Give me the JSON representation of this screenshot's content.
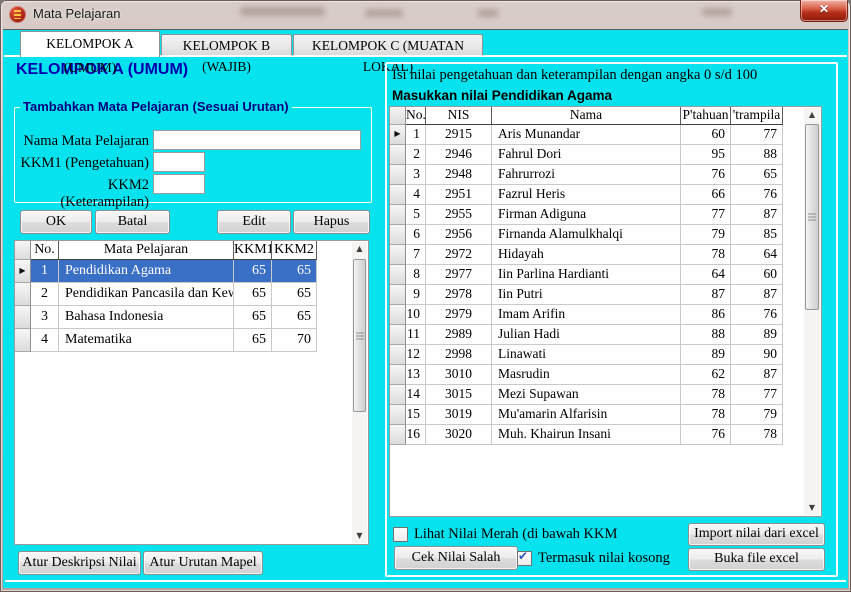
{
  "window": {
    "title": "Mata Pelajaran",
    "close_glyph": "✕"
  },
  "icons": {
    "up": "▲",
    "down": "▼",
    "row_arrow": "▶",
    "check": "✔"
  },
  "tabs": [
    {
      "label": "KELOMPOK A (UMUM)",
      "active": true
    },
    {
      "label": "KELOMPOK B (WAJIB)",
      "active": false
    },
    {
      "label": "KELOMPOK C (MUATAN LOKAL)",
      "active": false
    }
  ],
  "left": {
    "heading": "KELOMPOK A (UMUM)",
    "groupbox": {
      "dash": "-",
      "title": "Tambahkan Mata Pelajaran (Sesuai Urutan)",
      "fields": [
        {
          "label": "Nama Mata Pelajaran",
          "value": ""
        },
        {
          "label": "KKM1 (Pengetahuan)",
          "value": ""
        },
        {
          "label": "KKM2 (Keterampilan)",
          "value": ""
        }
      ]
    },
    "buttons": {
      "ok": "OK",
      "batal": "Batal",
      "edit": "Edit",
      "hapus": "Hapus"
    },
    "table": {
      "headers": [
        "No.",
        "Mata Pelajaran",
        "KKM1",
        "KKM2"
      ],
      "rows": [
        [
          "1",
          "Pendidikan Agama",
          "65",
          "65"
        ],
        [
          "2",
          "Pendidikan Pancasila dan Kewa",
          "65",
          "65"
        ],
        [
          "3",
          "Bahasa Indonesia",
          "65",
          "65"
        ],
        [
          "4",
          "Matematika",
          "65",
          "70"
        ]
      ],
      "selected_row": 0
    },
    "footer_buttons": {
      "deskripsi": "Atur Deskripsi Nilai",
      "urutan": "Atur Urutan Mapel"
    }
  },
  "right": {
    "dash": "-",
    "info_line": "Isi nilai pengetahuan dan keterampilan dengan angka 0 s/d 100",
    "subtitle": "Masukkan nilai Pendidikan Agama",
    "table": {
      "headers": [
        "No.",
        "NIS",
        "Nama",
        "P'tahuan",
        "'trampila"
      ],
      "rows": [
        [
          "1",
          "2915",
          "Aris Munandar",
          "60",
          "77"
        ],
        [
          "2",
          "2946",
          "Fahrul Dori",
          "95",
          "88"
        ],
        [
          "3",
          "2948",
          "Fahrurrozi",
          "76",
          "65"
        ],
        [
          "4",
          "2951",
          "Fazrul Heris",
          "66",
          "76"
        ],
        [
          "5",
          "2955",
          "Firman Adiguna",
          "77",
          "87"
        ],
        [
          "6",
          "2956",
          "Firnanda Alamulkhalqi",
          "79",
          "85"
        ],
        [
          "7",
          "2972",
          "Hidayah",
          "78",
          "64"
        ],
        [
          "8",
          "2977",
          "Iin Parlina Hardianti",
          "64",
          "60"
        ],
        [
          "9",
          "2978",
          "Iin Putri",
          "87",
          "87"
        ],
        [
          "10",
          "2979",
          "Imam Arifin",
          "86",
          "76"
        ],
        [
          "11",
          "2989",
          "Julian Hadi",
          "88",
          "89"
        ],
        [
          "12",
          "2998",
          "Linawati",
          "89",
          "90"
        ],
        [
          "13",
          "3010",
          "Masrudin",
          "62",
          "87"
        ],
        [
          "14",
          "3015",
          "Mezi Supawan",
          "78",
          "77"
        ],
        [
          "15",
          "3019",
          "Mu'amarin Alfarisin",
          "78",
          "79"
        ],
        [
          "16",
          "3020",
          "Muh. Khairun Insani",
          "76",
          "78"
        ]
      ]
    },
    "check_red": {
      "label": "Lihat Nilai Merah (di bawah KKM",
      "checked": false
    },
    "check_empty": {
      "label": "Termasuk nilai kosong",
      "checked": true
    },
    "buttons": {
      "cek": "Cek Nilai Salah",
      "import": "Import nilai dari excel",
      "buka": "Buka file excel"
    }
  },
  "colors": {
    "client_bg": "#06e2ee",
    "heading": "#0101ae",
    "group_label": "#00007e",
    "selected_row": "#3a6fc6",
    "close_button": "#b52d18"
  }
}
